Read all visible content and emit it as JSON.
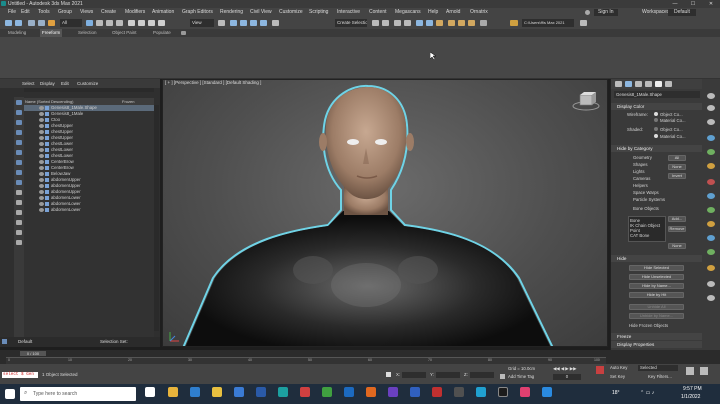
{
  "window": {
    "title": "Untitled - Autodesk 3ds Max 2021",
    "controls": [
      "—",
      "☐",
      "✕"
    ]
  },
  "menu": [
    "File",
    "Edit",
    "Tools",
    "Group",
    "Views",
    "Create",
    "Modifiers",
    "Animation",
    "Graph Editors",
    "Rendering",
    "Civil View",
    "Customize",
    "Scripting",
    "Interactive",
    "Content",
    "Megascans",
    "Help",
    "Arnold",
    "Ornatrix"
  ],
  "menu_right": {
    "signin": "Sign In",
    "workspaces": "Workspaces:",
    "workspace_value": "Default"
  },
  "toolbar": {
    "all_filter": "All",
    "view_dropdown": "View",
    "selection_set": "Create Selection Se",
    "path": "C:\\Users\\ff\\s Max 2021"
  },
  "ribbon_tabs": [
    "Modeling",
    "Freeform",
    "Selection",
    "Object Paint",
    "Populate"
  ],
  "scene_explorer": {
    "menu": [
      "Select",
      "Display",
      "Edit",
      "Customize"
    ],
    "col_name": "Name (Sorted Descending)",
    "col_frozen": "Frozen",
    "rows": [
      "Genesis8_1Male.Shape",
      "Genesis8_1Male",
      "Ctoo",
      "chestUpper",
      "chestUpper",
      "chestUpper",
      "chestLower",
      "chestLower",
      "chestLower",
      "CenterBrow",
      "CenterBrow",
      "BelowJaw",
      "abdomenUpper",
      "abdomenUpper",
      "abdomenUpper",
      "abdomenLower",
      "abdomenLower",
      "abdomenLower"
    ],
    "layer": "Default",
    "selection_set": "Selection Set:"
  },
  "viewport": {
    "label": "[ + ] [Perspective ] [Standard ] [Default Shading ]"
  },
  "right_panel": {
    "object_name": "Genesis8_1Male.Shape",
    "display_color": "Display Color",
    "wireframe": "Wireframe:",
    "shaded": "Shaded:",
    "object_color": "Object Co...",
    "material_color": "Material Co...",
    "hide_by_category": "Hide by Category",
    "categories": [
      "Geometry",
      "Shapes",
      "Lights",
      "Cameras",
      "Helpers",
      "Space Warps",
      "Particle Systems",
      "Bone Objects"
    ],
    "cat_buttons": [
      "All",
      "None",
      "Invert"
    ],
    "list": [
      "Bone",
      "IK Chain Object",
      "Point",
      "CAT Bone"
    ],
    "list_buttons": [
      "Add...",
      "Remove",
      "None"
    ],
    "hide": "Hide",
    "hide_buttons": [
      "Hide Selected",
      "Hide Unselected",
      "Hide by Name...",
      "Hide by Hit",
      "Unhide All",
      "Unhide by Name...",
      "Hide Frozen Objects"
    ],
    "freeze": "Freeze",
    "display_properties": "Display Properties"
  },
  "timeline": {
    "frame": "0 / 100",
    "ticks": [
      "0",
      "10",
      "20",
      "30",
      "40",
      "50",
      "60",
      "70",
      "80",
      "90",
      "100"
    ]
  },
  "status": {
    "script": "select $ Gen",
    "objects": "1 Object Selected",
    "grid": "Grid = 10.0cm",
    "add_time_tag": "Add Time Tag",
    "autokey": "Auto Key",
    "setkey": "Set Key",
    "selected": "Selected",
    "key_filters": "Key Filters...",
    "frame_field": "0",
    "x_label": "X:",
    "y_label": "Y:",
    "z_label": "Z:"
  },
  "taskbar": {
    "search": "Type here to search",
    "time": "9:57 PM",
    "date": "1/1/2022",
    "temp": "18°"
  },
  "colors": {
    "accent": "#7aa2d6",
    "selection_outline": "#6fd3e6",
    "suit": "#111111",
    "skin": "#b4967f"
  }
}
